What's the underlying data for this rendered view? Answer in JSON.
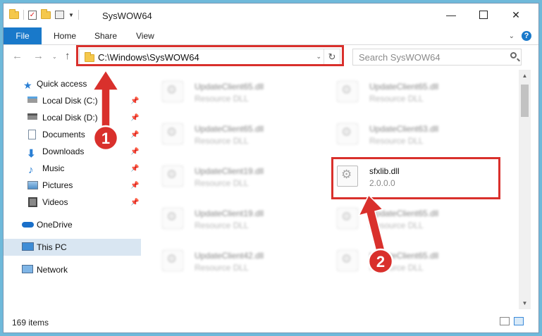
{
  "window": {
    "title": "SysWOW64",
    "controls": [
      "minimize-icon",
      "maximize-icon",
      "close-icon"
    ]
  },
  "ribbon": {
    "tabs": [
      "File",
      "Home",
      "Share",
      "View"
    ],
    "help_label": "?"
  },
  "nav": {
    "address": "C:\\Windows\\SysWOW64",
    "search_placeholder": "Search SysWOW64"
  },
  "sidebar": {
    "items": [
      {
        "label": "Quick access",
        "icon": "star-icon",
        "pinned": false
      },
      {
        "label": "Local Disk (C:)",
        "icon": "drive-icon",
        "pinned": true
      },
      {
        "label": "Local Disk (D:)",
        "icon": "drive-icon",
        "pinned": true
      },
      {
        "label": "Documents",
        "icon": "documents-icon",
        "pinned": true
      },
      {
        "label": "Downloads",
        "icon": "downloads-icon",
        "pinned": true
      },
      {
        "label": "Music",
        "icon": "music-icon",
        "pinned": true
      },
      {
        "label": "Pictures",
        "icon": "pictures-icon",
        "pinned": true
      },
      {
        "label": "Videos",
        "icon": "videos-icon",
        "pinned": true
      },
      {
        "label": "OneDrive",
        "icon": "cloud-icon",
        "pinned": false
      },
      {
        "label": "This PC",
        "icon": "computer-icon",
        "pinned": false,
        "selected": true
      },
      {
        "label": "Network",
        "icon": "network-icon",
        "pinned": false
      }
    ]
  },
  "files": [
    {
      "name": "UpdateClient65.dll",
      "type": "Resource DLL",
      "blurred": true
    },
    {
      "name": "UpdateClient65.dll",
      "type": "Resource DLL",
      "blurred": true
    },
    {
      "name": "UpdateClient65.dll",
      "type": "Resource DLL",
      "blurred": true
    },
    {
      "name": "UpdateClient63.dll",
      "type": "Resource DLL",
      "blurred": true
    },
    {
      "name": "UpdateClient19.dll",
      "type": "Resource DLL",
      "blurred": true
    },
    {
      "name": "sfxlib.dll",
      "type": "2.0.0.0",
      "blurred": false,
      "highlighted": true
    },
    {
      "name": "UpdateClient19.dll",
      "type": "Resource DLL",
      "blurred": true
    },
    {
      "name": "UpdateClient65.dll",
      "type": "Resource DLL",
      "blurred": true
    },
    {
      "name": "UpdateClient42.dll",
      "type": "Resource DLL",
      "blurred": true
    },
    {
      "name": "UpdateClient65.dll",
      "type": "Resource DLL",
      "blurred": true
    }
  ],
  "status": {
    "item_count": "169 items"
  },
  "annotations": {
    "step1": "1",
    "step2": "2",
    "color": "#d9302c"
  }
}
